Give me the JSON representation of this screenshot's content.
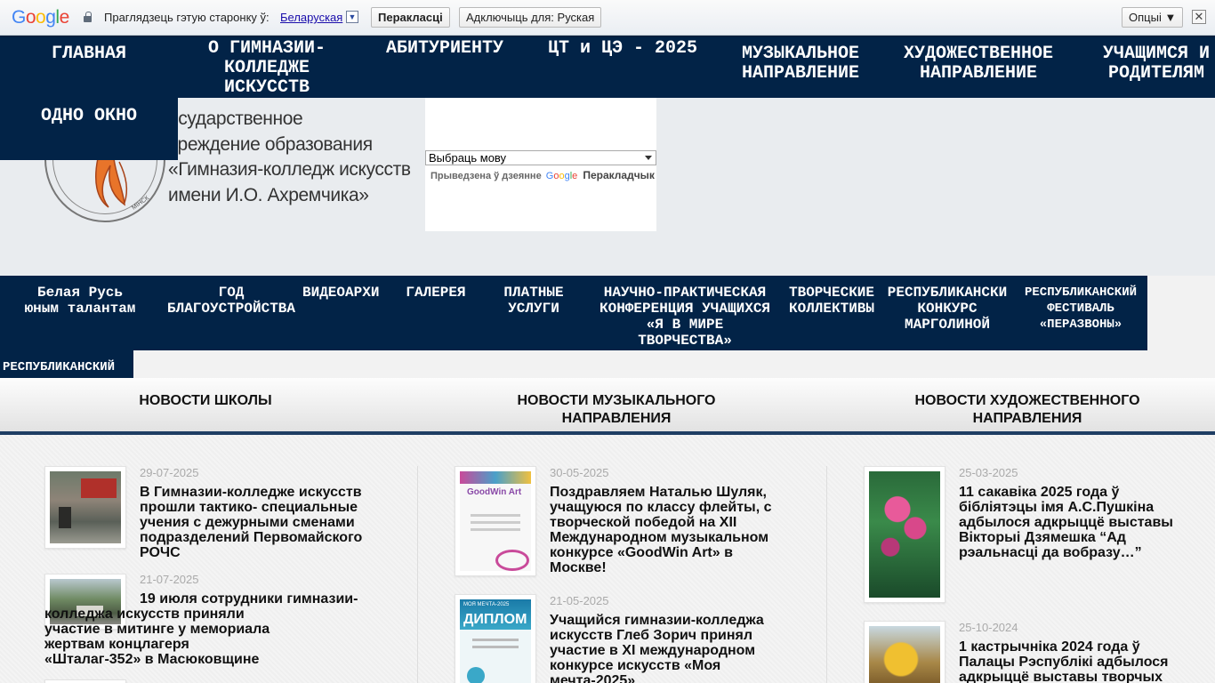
{
  "translate_bar": {
    "logo": "Google",
    "prompt": "Праглядзець гэтую старонку ў:",
    "language": "Беларуская",
    "translate_button": "Перакласці",
    "disable_button": "Адключыць для: Руская",
    "options_button": "Опцыі ▼",
    "close": "✕"
  },
  "main_nav": [
    {
      "label": "ГЛАВНАЯ"
    },
    {
      "label": "О ГИМНАЗИИ-\nКОЛЛЕДЖЕ\nИСКУССТВ"
    },
    {
      "label": "АБИТУРИЕНТУ"
    },
    {
      "label": "ЦТ и ЦЭ - 2025"
    },
    {
      "label": "МУЗЫКАЛЬНОЕ\nНАПРАВЛЕНИЕ"
    },
    {
      "label": "ХУДОЖЕСТВЕННОЕ\nНАПРАВЛЕНИЕ"
    },
    {
      "label": "УЧАЩИМСЯ И\nРОДИТЕЛЯМ"
    },
    {
      "label": "ОДНО ОКНО"
    }
  ],
  "header": {
    "logo_text": [
      "осударственное",
      "чреждение образования",
      "«Гимназия-колледж искусств",
      "имени И.О. Ахремчика»"
    ],
    "language_select": "Выбраць мову",
    "powered_by": "Прыведзена ў дзеянне",
    "google": "Google",
    "translator": "Перакладчык"
  },
  "sub_nav": [
    {
      "label": "Белая Русь\nюным талантам"
    },
    {
      "label": "ГОД\nБЛАГОУСТРОЙСТВА"
    },
    {
      "label": "ВИДЕОАРХИ"
    },
    {
      "label": "ГАЛЕРЕЯ"
    },
    {
      "label": "ПЛАТНЫЕ\nУСЛУГИ"
    },
    {
      "label": "НАУЧНО-ПРАКТИЧЕСКАЯ\nКОНФЕРЕНЦИЯ УЧАЩИХСЯ\n«Я В МИРЕ\nТВОРЧЕСТВА»"
    },
    {
      "label": "ТВОРЧЕСКИЕ\nКОЛЛЕКТИВЫ"
    },
    {
      "label": "РЕСПУБЛИКАНСКИ\nКОНКУРС\nМАРГОЛИНОЙ"
    },
    {
      "label": "РЕСПУБЛИКАНСКИЙ\nФЕСТИВАЛЬ\n«ПЕРАЗВОНЫ»"
    },
    {
      "label": "РЕСПУБЛИКАНСКИЙ"
    }
  ],
  "tabs": [
    {
      "label": "НОВОСТИ ШКОЛЫ"
    },
    {
      "label": "НОВОСТИ МУЗЫКАЛЬНОГО\nНАПРАВЛЕНИЯ"
    },
    {
      "label": "НОВОСТИ ХУДОЖЕСТВЕННОГО\nНАПРАВЛЕНИЯ"
    }
  ],
  "news": {
    "school": [
      {
        "date": "29-07-2025",
        "title": "В Гимназии-колледже искусств\nпрошли тактико- специальные\nучения с дежурными сменами\nподразделений Первомайского\nРОЧС"
      },
      {
        "date": "21-07-2025",
        "title": "19 июля сотрудники гимназии-\nколледжа искусств приняли\nучастие в митинге у мемориала\nжертвам концлагеря\n«Шталаг-352» в Масюковщине"
      }
    ],
    "music": [
      {
        "date": "30-05-2025",
        "title": "Поздравляем Наталью Шуляк,\nучащуюся по классу флейты, с\nтворческой победой на XII\nМеждународном музыкальном\nконкурсе «GoodWin Art» в\nМоскве!"
      },
      {
        "date": "21-05-2025",
        "title": "Учащийся гимназии-колледжа\nискусств Глеб Зорич принял\nучастие в XI международном\nконкурсе искусств «Моя\nмечта-2025»"
      }
    ],
    "art": [
      {
        "date": "25-03-2025",
        "title": "11 сакавіка 2025 года ў\nбібліятэцы імя А.С.Пушкіна\nадбылося адкрыццё выставы\nВікторыі Дзямешка “Ад\nрэальнасці да вобразу…”"
      },
      {
        "date": "25-10-2024",
        "title": "1 кастрычніка 2024 года ў\nПалацы Рэспублікі адбылося\nадкрыццё выставы творчых"
      }
    ]
  },
  "thumb_labels": {
    "diploma1": "GoodWin Art",
    "diploma2": "ДИПЛОМ",
    "diploma2_top": "МОЯ МЕЧТА-2025"
  }
}
